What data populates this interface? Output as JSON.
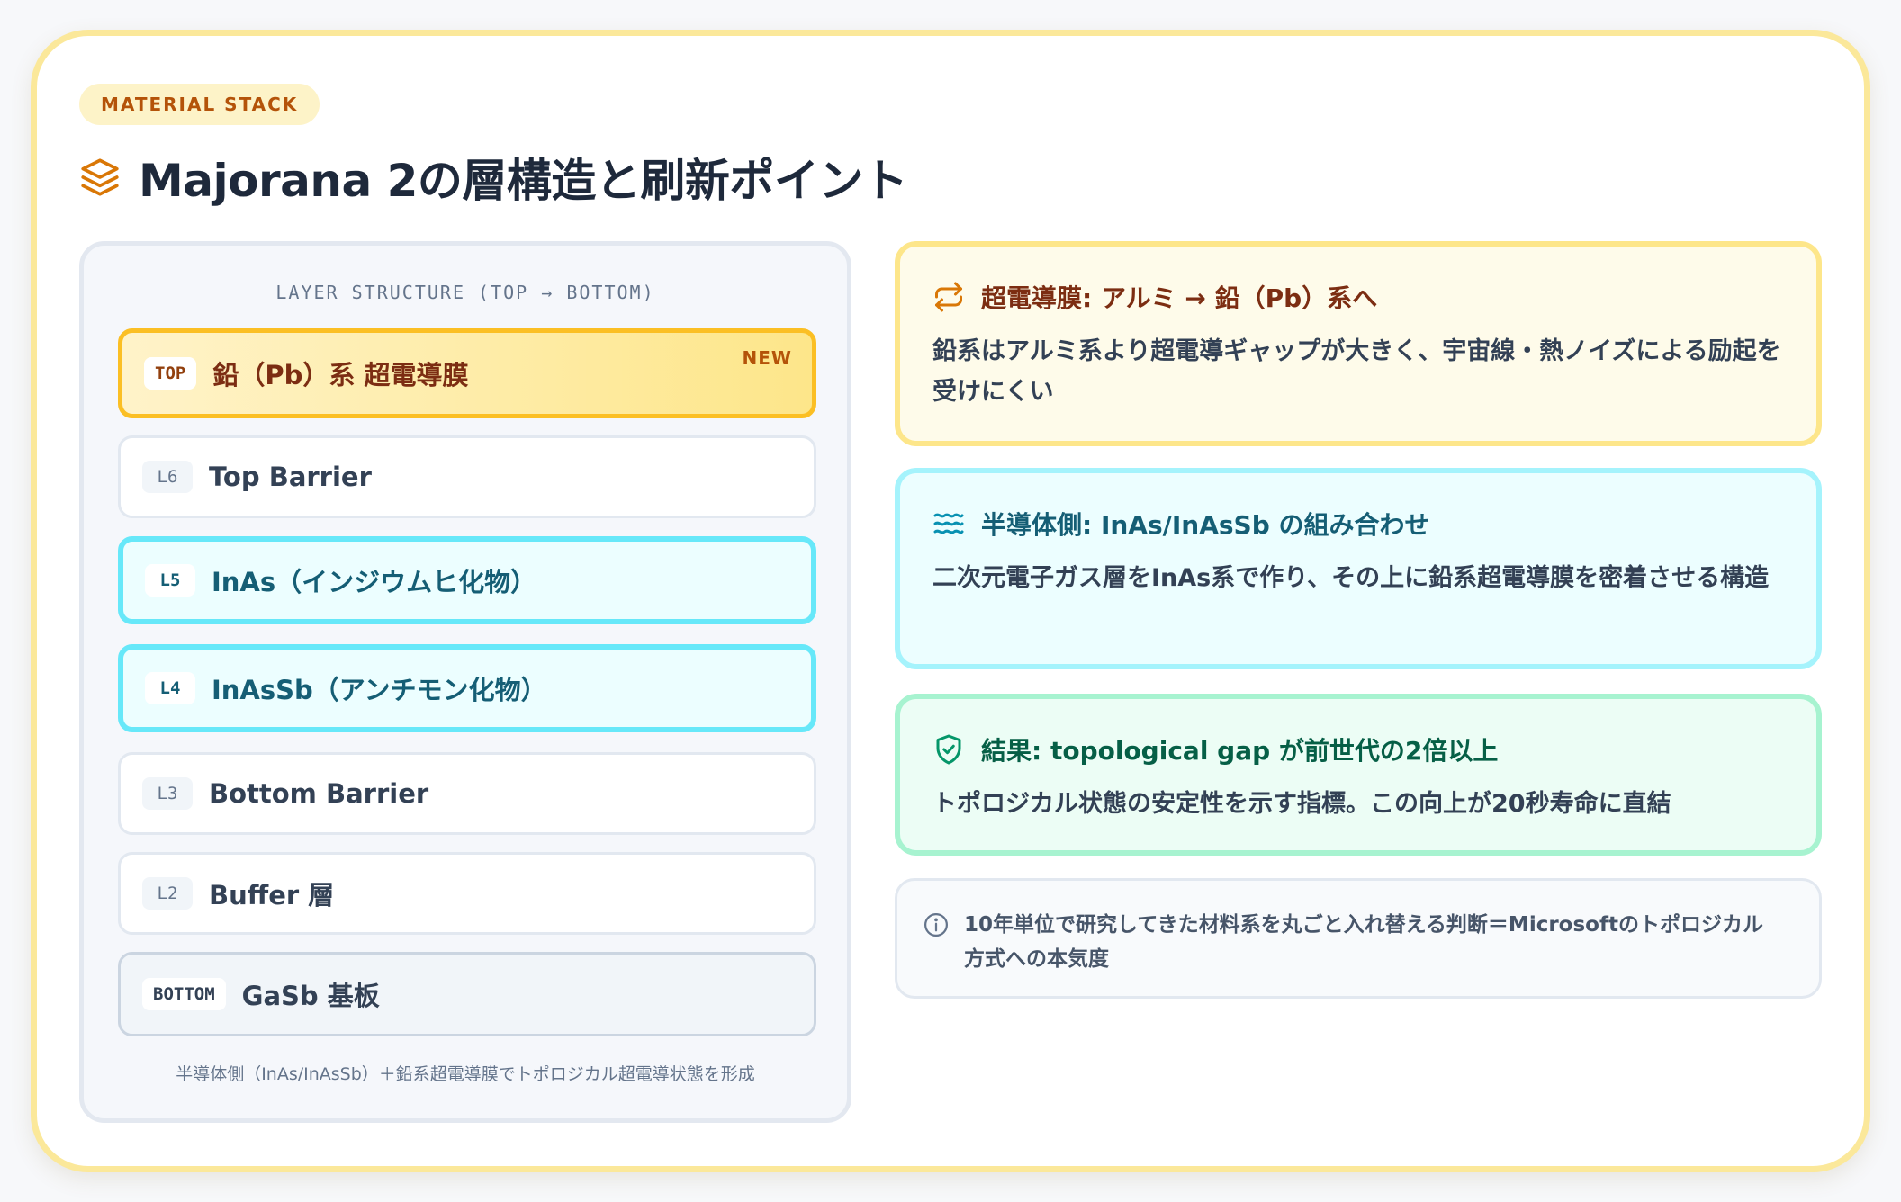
{
  "badge": "MATERIAL STACK",
  "title": "Majorana 2の層構造と刷新ポイント",
  "stack": {
    "header": "LAYER STRUCTURE (TOP → BOTTOM)",
    "layers": [
      {
        "tag": "TOP",
        "label": "鉛（Pb）系 超電導膜",
        "flag": "NEW"
      },
      {
        "tag": "L6",
        "label": "Top Barrier"
      },
      {
        "tag": "L5",
        "label": "InAs（インジウムヒ化物）"
      },
      {
        "tag": "L4",
        "label": "InAsSb（アンチモン化物）"
      },
      {
        "tag": "L3",
        "label": "Bottom Barrier"
      },
      {
        "tag": "L2",
        "label": "Buffer 層"
      },
      {
        "tag": "BOTTOM",
        "label": "GaSb 基板"
      }
    ],
    "footer": "半導体側（InAs/InAsSb）＋鉛系超電導膜でトポロジカル超電導状態を形成"
  },
  "cards": [
    {
      "icon": "swap-arrows-icon",
      "heading": "超電導膜: アルミ → 鉛（Pb）系へ",
      "body": "鉛系はアルミ系より超電導ギャップが大きく、宇宙線・熱ノイズによる励起を受けにくい",
      "accent": "#d97706"
    },
    {
      "icon": "waves-icon",
      "heading": "半導体側: InAs/InAsSb の組み合わせ",
      "body": "二次元電子ガス層をInAs系で作り、その上に鉛系超電導膜を密着させる構造",
      "accent": "#0891b2"
    },
    {
      "icon": "shield-check-icon",
      "heading": "結果: topological gap が前世代の2倍以上",
      "body": "トポロジカル状態の安定性を示す指標。この向上が20秒寿命に直結",
      "accent": "#059669"
    }
  ],
  "note": {
    "icon": "info-icon",
    "text": "10年単位で研究してきた材料系を丸ごと入れ替える判断＝Microsoftのトポロジカル方式への本気度"
  },
  "colors": {
    "frame": "#fbe89a",
    "brand": "#d97706"
  }
}
